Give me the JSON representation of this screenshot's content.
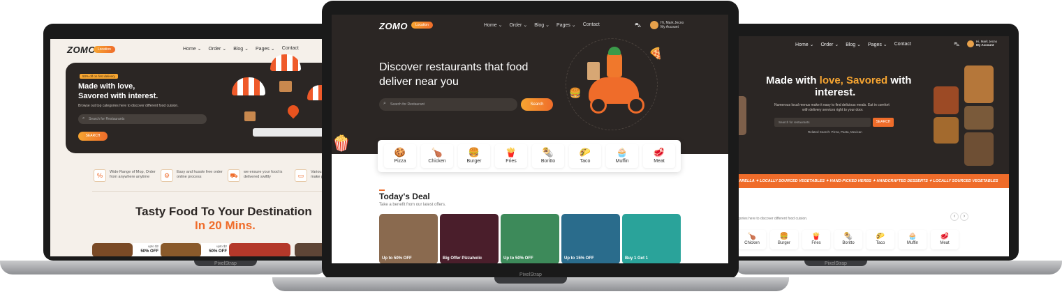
{
  "brand": {
    "logo": "ZOMO",
    "location": "Location",
    "footer_brand": "PixelStrap"
  },
  "nav": {
    "items": [
      "Home ⌄",
      "Order ⌄",
      "Blog ⌄",
      "Pages ⌄",
      "Contact"
    ]
  },
  "account": {
    "greeting": "Hi, Mark Jecno",
    "label": "My Account"
  },
  "left_screen": {
    "badge": "50% off on first delivery",
    "hero_title_1": "Made with love,",
    "hero_title_2": "Savored with interest.",
    "hero_desc": "Browse out top categories here to discover different food cuision.",
    "search_placeholder": "Search for Restaurants",
    "search_button": "SEARCH",
    "features": [
      {
        "icon": "%",
        "text_1": "Wide Range of Mop, Order",
        "text_2": "from anywhere anytime"
      },
      {
        "icon": "⚙",
        "text_1": "Easy and hussle free order",
        "text_2": "online process"
      },
      {
        "icon": "⛟",
        "text_1": "we ensure your food is",
        "text_2": "delivered swiftly"
      },
      {
        "icon": "▭",
        "text_1": "Various",
        "text_2": "make p"
      }
    ],
    "tagline_1": "Tasty Food To Your Destination",
    "tagline_2": "In 20 Mins.",
    "offers": [
      {
        "top": "upto $2",
        "bottom": "50% OFF"
      },
      {
        "top": "upto $2",
        "bottom": "50% OFF"
      }
    ]
  },
  "center_screen": {
    "hero_title_1": "Discover restaurants that food",
    "hero_title_2": "deliver near you",
    "search_placeholder": "Search for Restaurant",
    "search_button": "Search",
    "categories": [
      {
        "icon": "🍪",
        "label": "Pizza"
      },
      {
        "icon": "🍗",
        "label": "Chicken"
      },
      {
        "icon": "🍔",
        "label": "Burger"
      },
      {
        "icon": "🍟",
        "label": "Fries"
      },
      {
        "icon": "🌯",
        "label": "Boritto"
      },
      {
        "icon": "🌮",
        "label": "Taco"
      },
      {
        "icon": "🧁",
        "label": "Muffin"
      },
      {
        "icon": "🥩",
        "label": "Meat"
      }
    ],
    "section_title": "Today's Deal",
    "section_sub": "Take a benefit from our latest offers.",
    "deals": [
      {
        "text": "Up to 50% OFF",
        "color": "#8a6a4f"
      },
      {
        "text": "Big Offer Pizzaholic",
        "color": "#4a1e2b"
      },
      {
        "text": "Up to 50% OFF",
        "color": "#3d8a5a"
      },
      {
        "text": "Up to 15% OFF",
        "color": "#2a6c8c"
      },
      {
        "text": "Buy 1 Get 1",
        "color": "#2aa39a"
      }
    ]
  },
  "right_screen": {
    "hero_pre": "Made with ",
    "hero_accent": "love, Savored",
    "hero_post": " with",
    "hero_line2": "interest.",
    "hero_desc_1": "Numerous local menus make it easy to find delicious meals. Eat in comfort",
    "hero_desc_2": "with delivery services right to your door.",
    "search_placeholder": "Search for restaurants",
    "search_button": "SEARCH",
    "related": "Related Search: Pizza, Pasta, Mexican",
    "marquee": "ZARELLA  ✦  LOCALLY SOURCED VEGETABLES  ✦  HAND-PICKED HERBS  ✦  HANDCRAFTED DESSERTS  ✦  LOCALLY SOURCED VEGETABLES",
    "subtext": "gories here to discover different food cuision.",
    "prev": "‹",
    "next": "›",
    "categories": [
      {
        "icon": "🍗",
        "label": "Chicken"
      },
      {
        "icon": "🍔",
        "label": "Burger"
      },
      {
        "icon": "🍟",
        "label": "Fries"
      },
      {
        "icon": "🌯",
        "label": "Boritto"
      },
      {
        "icon": "🌮",
        "label": "Taco"
      },
      {
        "icon": "🧁",
        "label": "Muffin"
      },
      {
        "icon": "🥩",
        "label": "Meat"
      }
    ]
  },
  "colors": {
    "accent": "#ef6c2a",
    "accent_light": "#f7a531",
    "dark": "#2b2624"
  }
}
